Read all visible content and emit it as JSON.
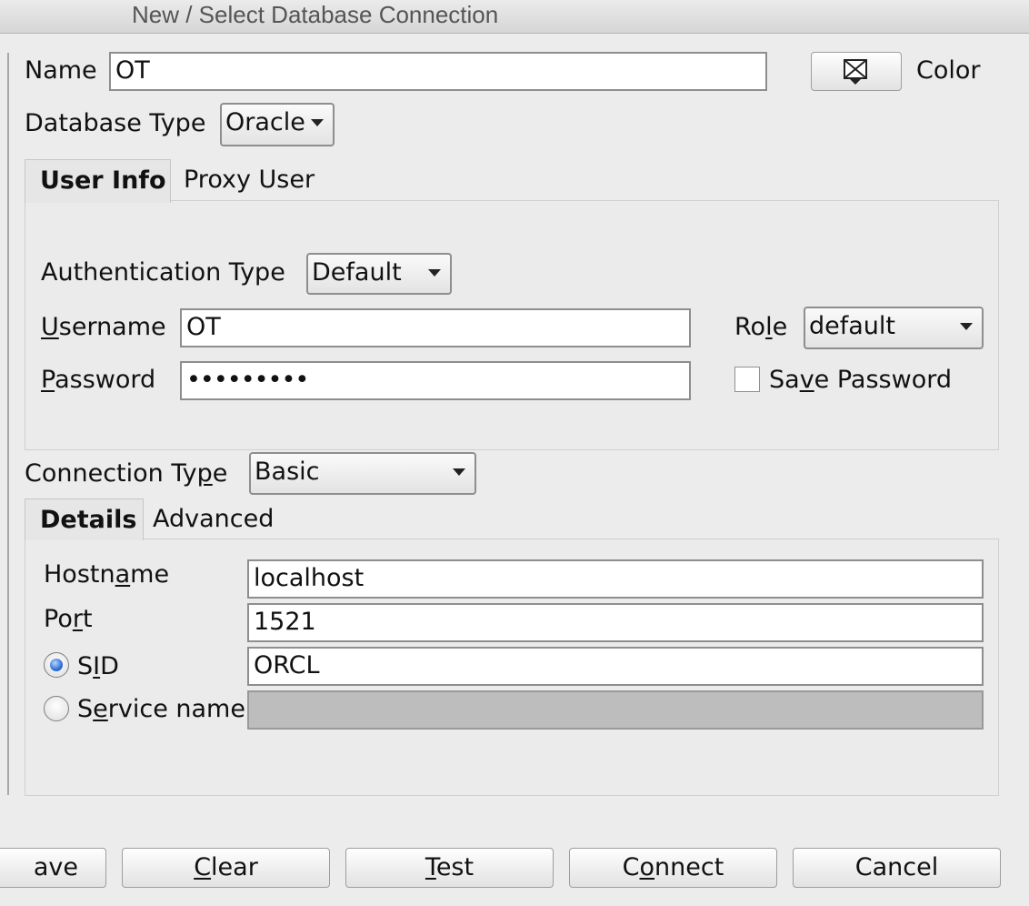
{
  "window": {
    "title": "New / Select Database Connection"
  },
  "connection": {
    "name_label": "Name",
    "name_value": "OT",
    "color_label": "Color",
    "color_icon": "color-picker-icon",
    "db_type_label": "Database Type",
    "db_type_value": "Oracle"
  },
  "user_tabs": [
    "User Info",
    "Proxy User"
  ],
  "user_info": {
    "auth_type_label": "Authentication Type",
    "auth_type_value": "Default",
    "username_label_u": "U",
    "username_label_rest": "sername",
    "username_value": "OT",
    "role_label_pre": "Ro",
    "role_label_u": "l",
    "role_label_post": "e",
    "role_value": "default",
    "password_label_u": "P",
    "password_label_rest": "assword",
    "password_value": "•••••••••",
    "save_password_pre": "Sa",
    "save_password_u": "v",
    "save_password_post": "e Password",
    "save_password_checked": false
  },
  "connection_type": {
    "label_pre": "Connection Ty",
    "label_u": "p",
    "label_post": "e",
    "value": "Basic"
  },
  "detail_tabs": [
    "Details",
    "Advanced"
  ],
  "details": {
    "hostname_pre": "Hostn",
    "hostname_u": "a",
    "hostname_post": "me",
    "hostname_value": "localhost",
    "port_pre": "Po",
    "port_u": "r",
    "port_post": "t",
    "port_value": "1521",
    "sid_pre": "S",
    "sid_u": "I",
    "sid_post": "D",
    "sid_value": "ORCL",
    "sid_selected": true,
    "service_pre": "S",
    "service_u": "e",
    "service_post": "rvice name",
    "service_value": ""
  },
  "buttons": {
    "save": "ave",
    "clear_u": "C",
    "clear_rest": "lear",
    "test_u": "T",
    "test_rest": "est",
    "connect_pre": "C",
    "connect_u": "o",
    "connect_post": "nnect",
    "cancel": "Cancel"
  }
}
